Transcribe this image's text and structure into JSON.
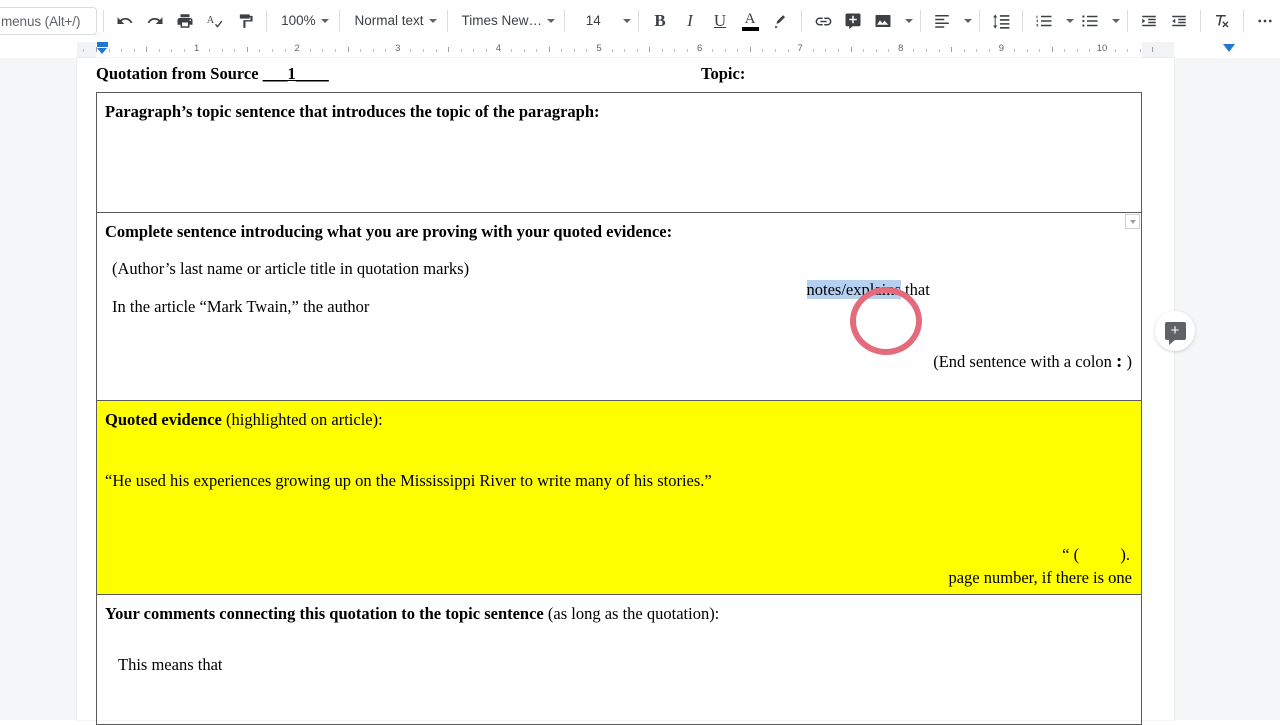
{
  "toolbar": {
    "search_placeholder": "menus (Alt+/)",
    "undo_label": "Undo",
    "redo_label": "Redo",
    "print_label": "Print",
    "spelling_label": "Spelling and grammar check",
    "paint_format_label": "Paint format",
    "zoom_value": "100%",
    "style_value": "Normal text",
    "font_value": "Times New…",
    "font_size_value": "14",
    "bold_label": "B",
    "italic_label": "I",
    "underline_label": "U",
    "text_color_label": "A",
    "highlight_label": "Highlight color",
    "link_label": "Insert link",
    "comment_label": "Add comment",
    "image_label": "Insert image",
    "align_label": "Align",
    "line_spacing_label": "Line spacing",
    "numbered_list_label": "Numbered list",
    "bulleted_list_label": "Bulleted list",
    "decrease_indent_label": "Decrease indent",
    "increase_indent_label": "Increase indent",
    "clear_formatting_label": "Clear formatting",
    "more_label": "More"
  },
  "ruler": {
    "numbers": [
      "1",
      "2",
      "3",
      "4",
      "5",
      "6",
      "7",
      "8",
      "9",
      "10"
    ]
  },
  "document": {
    "header": {
      "lead": "Quotation from Source ",
      "source_number": "___1____",
      "topic_label": "Topic:"
    },
    "cells": {
      "topic_sentence": {
        "heading": "Paragraph’s topic sentence that introduces the topic of the paragraph:"
      },
      "intro_sentence": {
        "heading": "Complete sentence introducing what you are proving with your quoted evidence:",
        "hint": "(Author’s last name or article title in quotation marks)",
        "student_text": "In the article “Mark Twain,” the author",
        "selected_text": "notes/explains",
        "trailing_text": " that",
        "footer_prefix": "(End sentence with a colon ",
        "footer_colon": ":",
        "footer_suffix": " )"
      },
      "quoted_evidence": {
        "heading_bold": "Quoted evidence",
        "heading_rest": " (highlighted on article):",
        "quote": "“He used his experiences growing up on the Mississippi River to write many of his stories.”",
        "citation_template": "“ (          ).",
        "citation_note": "page number, if there is one"
      },
      "comments": {
        "heading_bold": "Your comments connecting this quotation to the topic sentence",
        "heading_rest": " (as long as the quotation):",
        "student_text": "This means that"
      }
    }
  },
  "annotations": {
    "circle_color": "#e36b7c",
    "selection_color": "#b6d0f2",
    "highlight_color": "#ffff00"
  },
  "floating": {
    "add_comment_label": "Add comment",
    "cell_dropdown_label": "Table cell options"
  }
}
